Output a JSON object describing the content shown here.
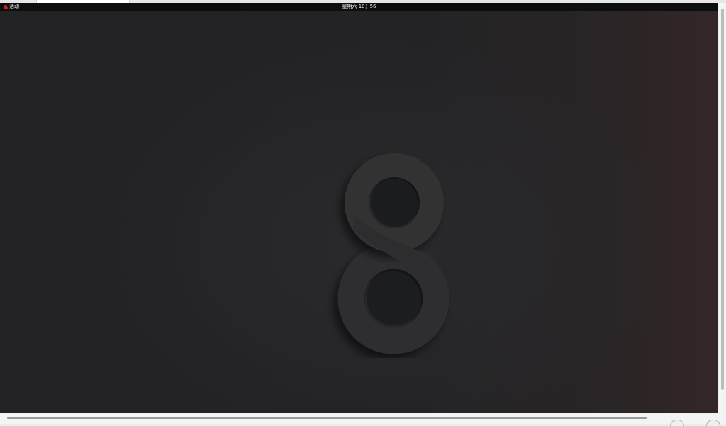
{
  "topbar": {
    "activities_label": "活动",
    "activities_icon": "redhat-icon",
    "clock": "星期六 10：56"
  },
  "desktop": {
    "wallpaper_logo": "rhel-8-logo",
    "background_color": "#232325",
    "logo_color": "#2e2e31"
  }
}
